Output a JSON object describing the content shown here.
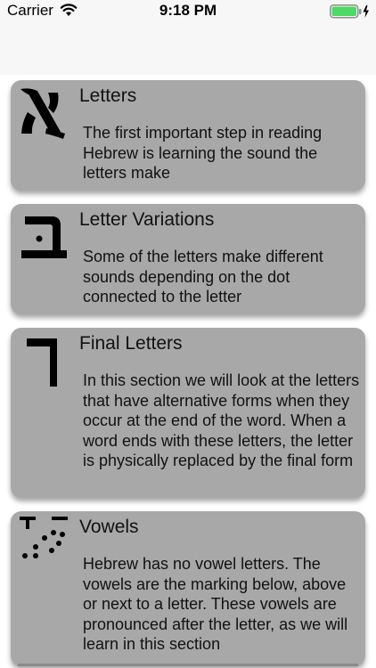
{
  "status_bar": {
    "carrier": "Carrier",
    "time": "9:18 PM",
    "battery_color": "#4cd964"
  },
  "lessons": [
    {
      "title": "Letters",
      "description": "The first important step in reading Hebrew is learning the sound the letters make",
      "icon": "hebrew-aleph-icon"
    },
    {
      "title": "Letter Variations",
      "description": "Some of the letters make different sounds depending on the dot connected to the letter",
      "icon": "hebrew-bet-icon"
    },
    {
      "title": "Final Letters",
      "description": "In this section we will look at the letters that have alternative forms when they occur at the end of the word. When a word ends with these letters, the letter is physically replaced by the final form",
      "icon": "hebrew-final-kaf-icon"
    },
    {
      "title": "Vowels",
      "description": "Hebrew has no vowel letters. The vowels are the marking below, above or next to a letter. These vowels are pronounced after the letter, as we will learn in this section",
      "icon": "hebrew-vowels-icon"
    }
  ]
}
